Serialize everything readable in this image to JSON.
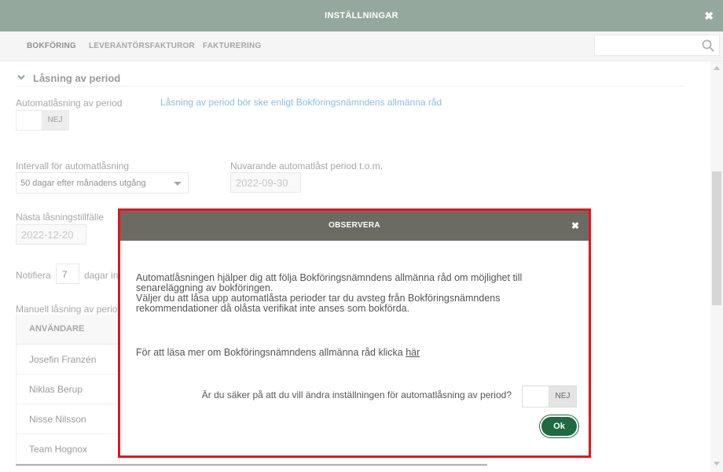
{
  "window": {
    "title": "INSTÄLLNINGAR",
    "close_icon": "close-icon"
  },
  "tabs": [
    {
      "label": "BOKFÖRING",
      "active": true
    },
    {
      "label": "LEVERANTÖRSFAKTUROR",
      "active": false
    },
    {
      "label": "FAKTURERING",
      "active": false
    }
  ],
  "search": {
    "placeholder": "",
    "value": ""
  },
  "section": {
    "title": "Låsning av period"
  },
  "autolock": {
    "label": "Automatlåsning av period",
    "toggle_label": "NEJ",
    "link": "Låsning av period bör ske enligt Bokföringsnämndens allmänna råd"
  },
  "interval": {
    "label": "Intervall för automatlåsning",
    "value": "50 dagar efter månadens utgång"
  },
  "current_period": {
    "label": "Nuvarande automatlåst period t.o.m.",
    "value": "2022-09-30"
  },
  "next_lock": {
    "label": "Nästa låsningstillfälle",
    "value": "2022-12-20"
  },
  "notify": {
    "label": "Notifiera",
    "value": "7",
    "suffix": "dagar in"
  },
  "manual": {
    "label": "Manuell låsning av perio",
    "column": "ANVÄNDARE",
    "users": [
      "Josefin Franzén",
      "Niklas Berup",
      "Nisse Nilsson",
      "Team Hognox"
    ]
  },
  "modal": {
    "title": "OBSERVERA",
    "para1_line1": "Automatlåsningen hjälper dig att följa Bokföringsnämndens allmänna råd om möjlighet till",
    "para1_line2": "senareläggning av bokföringen.",
    "para1_line3": "Väljer du att låsa upp automatlåsta perioder tar du avsteg från Bokföringsnämndens",
    "para1_line4": "rekommendationer då olåsta verifikat inte anses som bokförda.",
    "para2_text": "För att läsa mer om Bokföringsnämndens allmänna råd klicka ",
    "para2_link": "här",
    "question": "Är du säker på att du vill ändra inställningen för automatlåsning av period?",
    "toggle_label": "NEJ",
    "ok_label": "Ok"
  },
  "colors": {
    "titlebar": "#5d7a69",
    "modal_header": "#6b6b63",
    "modal_border": "#e8141c",
    "ok_button": "#1f6a40",
    "link": "#4a9bd1"
  }
}
